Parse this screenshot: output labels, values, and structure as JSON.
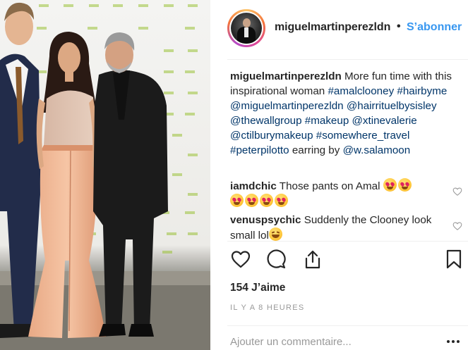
{
  "post": {
    "username": "miguelmartinperezldn",
    "separator": "•",
    "follow_label": "S’abonner",
    "caption": {
      "user": "miguelmartinperezldn",
      "parts": [
        {
          "t": " More fun time with this inspirational woman "
        },
        {
          "t": "#amalclooney",
          "tag": true
        },
        {
          "t": " "
        },
        {
          "t": "#hairbyme",
          "tag": true
        },
        {
          "t": " "
        },
        {
          "t": "@miguelmartinperezldn",
          "tag": true
        },
        {
          "t": " "
        },
        {
          "t": "@hairrituelbysisley",
          "tag": true
        },
        {
          "t": " "
        },
        {
          "t": "@thewallgroup",
          "tag": true
        },
        {
          "t": " "
        },
        {
          "t": "#makeup",
          "tag": true
        },
        {
          "t": " "
        },
        {
          "t": "@xtinevalerie",
          "tag": true
        },
        {
          "t": " "
        },
        {
          "t": "@ctilburymakeup",
          "tag": true
        },
        {
          "t": " "
        },
        {
          "t": "#somewhere_travel",
          "tag": true
        },
        {
          "t": " "
        },
        {
          "t": "#peterpilotto",
          "tag": true
        },
        {
          "t": " earring by "
        },
        {
          "t": "@w.salamoon",
          "tag": true
        }
      ]
    },
    "comments": [
      {
        "user": "iamdchic",
        "text": " Those pants on Amal",
        "emoji_names": [
          "heart-eyes-emoji",
          "heart-eyes-emoji",
          "heart-eyes-emoji",
          "heart-eyes-emoji",
          "heart-eyes-emoji",
          "heart-eyes-emoji"
        ]
      },
      {
        "user": "venuspsychic",
        "text": " Suddenly the Clooney look small lol",
        "emoji_names": [
          "laughing-emoji"
        ]
      }
    ],
    "likes": "154 J’aime",
    "time": "IL Y A 8 HEURES",
    "comment_placeholder": "Ajouter un commentaire...",
    "icons": {
      "like": "heart-icon",
      "comment": "comment-bubble-icon",
      "share": "share-upload-icon",
      "save": "bookmark-icon",
      "more": "more-dots-icon"
    },
    "colors": {
      "link": "#3897f0",
      "tag": "#003569",
      "secondary": "#999999"
    }
  }
}
